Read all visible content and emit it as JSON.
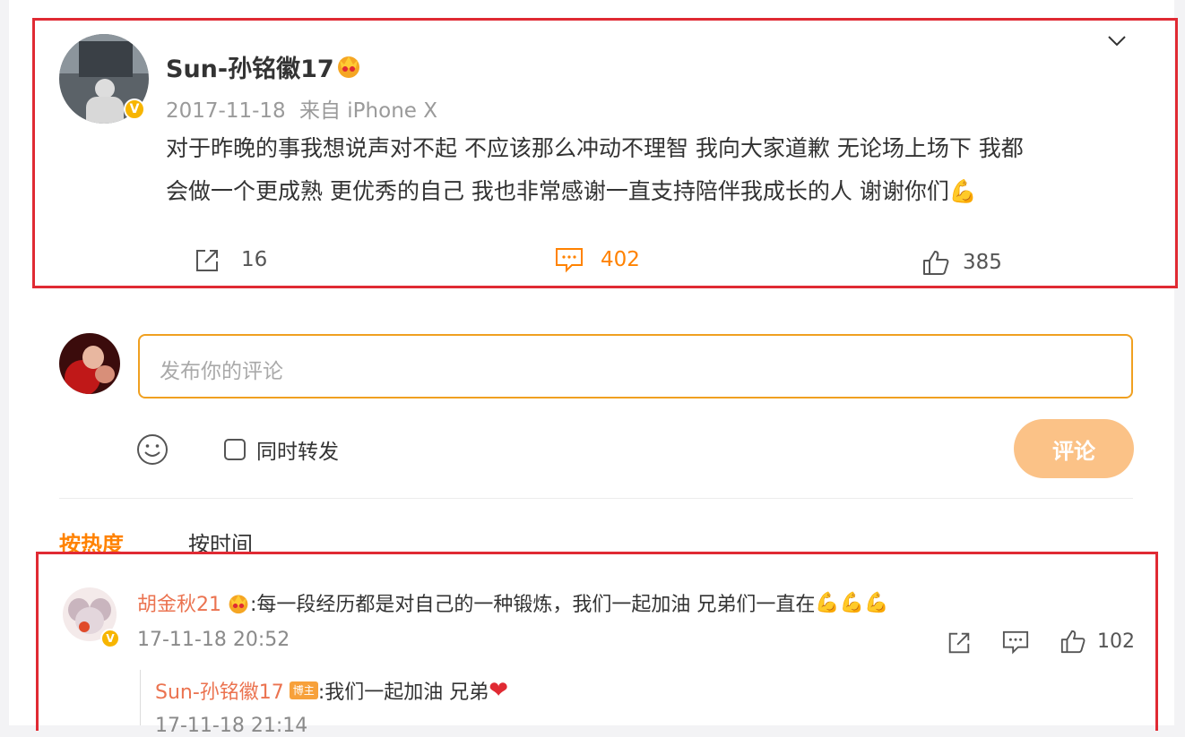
{
  "post": {
    "author": "Sun-孙铭徽17",
    "date": "2017-11-18",
    "source_prefix": "来自",
    "source": "iPhone X",
    "text_line1": "对于昨晚的事我想说声对不起 不应该那么冲动不理智 我向大家道歉  无论场上场下 我都",
    "text_line2": "会做一个更成熟 更优秀的自己 我也非常感谢一直支持陪伴我成长的人 谢谢你们",
    "text_emoji": "💪",
    "reposts": "16",
    "comments": "402",
    "likes": "385"
  },
  "composer": {
    "placeholder": "发布你的评论",
    "repost_label": "同时转发",
    "submit_label": "评论"
  },
  "sort_tabs": {
    "hot": "按热度",
    "time": "按时间"
  },
  "comment": {
    "author": "胡金秋21",
    "text": ":每一段经历都是对自己的一种锻炼，我们一起加油 兄弟们一直在",
    "emoji": "💪💪💪",
    "time": "17-11-18 20:52",
    "likes": "102",
    "reply": {
      "author": "Sun-孙铭徽17",
      "badge": "博主",
      "text": ":我们一起加油 兄弟",
      "emoji": "❤",
      "time": "17-11-18 21:14"
    }
  },
  "colors": {
    "accent": "#ff8200",
    "highlight_box": "#e02a33",
    "link_name": "#eb7350"
  }
}
